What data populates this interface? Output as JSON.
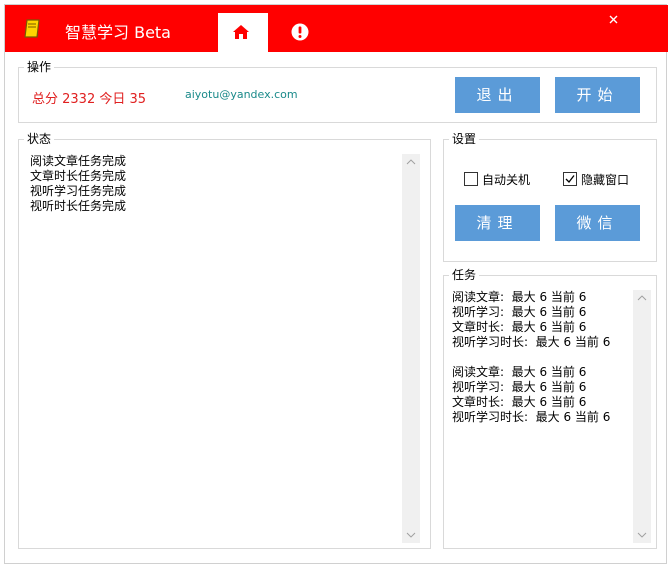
{
  "window": {
    "title": "智慧学习 Beta",
    "accent_color": "#ff0000",
    "tabs": [
      {
        "icon": "home-icon",
        "active": true
      },
      {
        "icon": "alert-icon",
        "active": false
      }
    ],
    "close_icon": "close-icon"
  },
  "operation": {
    "title": "操作",
    "score_text": "总分 2332  今日 35",
    "email": "aiyotu@yandex.com",
    "logout_label": "退出",
    "start_label": "开始"
  },
  "status": {
    "title": "状态",
    "log": "阅读文章任务完成\n文章时长任务完成\n视听学习任务完成\n视听时长任务完成"
  },
  "settings": {
    "title": "设置",
    "auto_shutdown_label": "自动关机",
    "auto_shutdown_checked": false,
    "hide_window_label": "隐藏窗口",
    "hide_window_checked": true,
    "clean_label": "清理",
    "wechat_label": "微信"
  },
  "tasks": {
    "title": "任务",
    "log": "阅读文章:  最大 6 当前 6\n视听学习:  最大 6 当前 6\n文章时长:  最大 6 当前 6\n视听学习时长:  最大 6 当前 6\n\n阅读文章:  最大 6 当前 6\n视听学习:  最大 6 当前 6\n文章时长:  最大 6 当前 6\n视听学习时长:  最大 6 当前 6"
  }
}
